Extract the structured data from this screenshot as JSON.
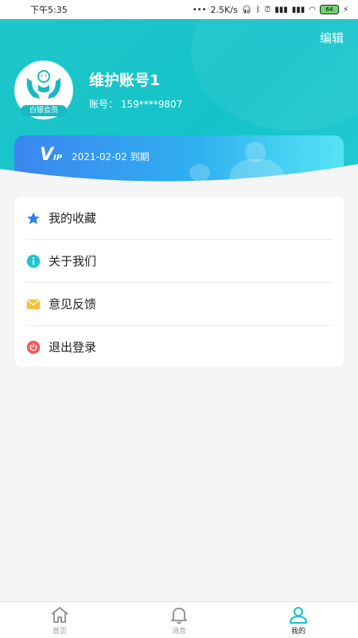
{
  "status_bar": {
    "time": "下午5:35",
    "network_speed": "2.5K/s",
    "battery": "64"
  },
  "header": {
    "edit_label": "编辑",
    "username": "维护账号1",
    "account_label": "账号：",
    "account_number": "159****9807",
    "member_level": "白银会员"
  },
  "vip": {
    "logo_main": "V",
    "logo_sub": "IP",
    "expiry_date": "2021-02-02",
    "expiry_suffix": "到期"
  },
  "menu": {
    "items": [
      {
        "label": "我的收藏",
        "icon": "star-icon"
      },
      {
        "label": "关于我们",
        "icon": "info-icon"
      },
      {
        "label": "意见反馈",
        "icon": "envelope-icon"
      },
      {
        "label": "退出登录",
        "icon": "power-icon"
      }
    ]
  },
  "tabbar": {
    "tabs": [
      {
        "label": "首页",
        "icon": "home-icon"
      },
      {
        "label": "消息",
        "icon": "bell-icon"
      },
      {
        "label": "我的",
        "icon": "user-icon",
        "active": true
      }
    ]
  },
  "colors": {
    "accent": "#14c3c9",
    "vip_start": "#3b86ef",
    "vip_end": "#55e4f3",
    "star": "#2f7fe9",
    "info": "#20c4d0",
    "envelope": "#f2c23c",
    "power": "#ef5a5a"
  }
}
